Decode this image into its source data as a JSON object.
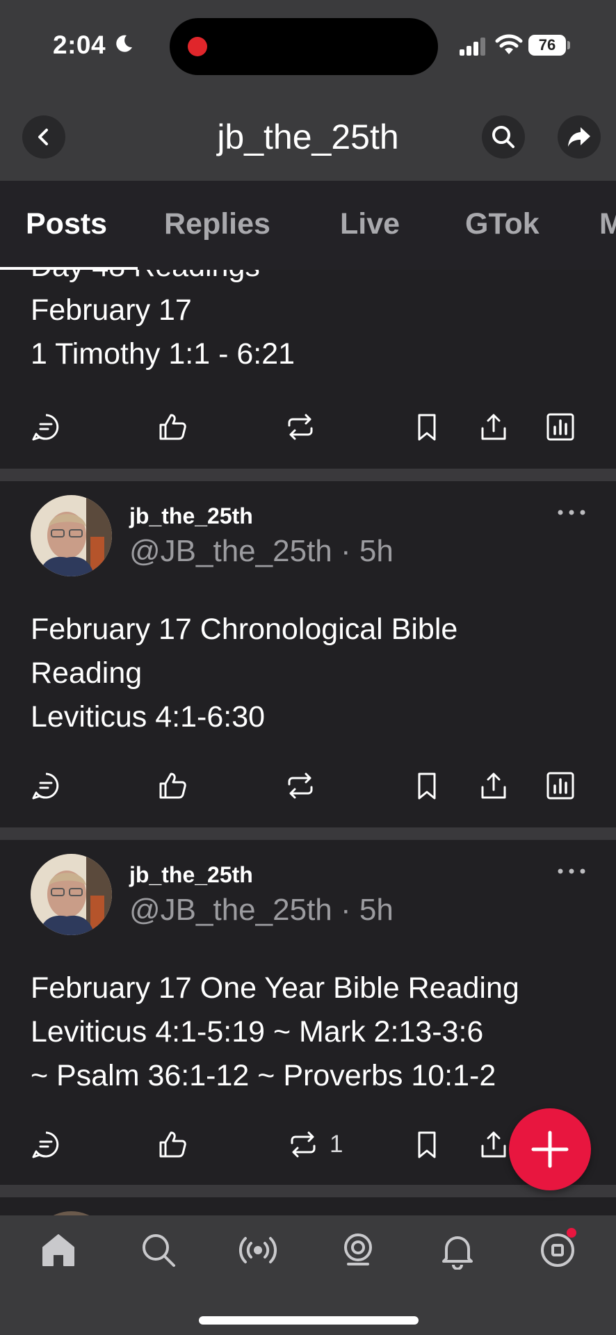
{
  "status_bar": {
    "time": "2:04",
    "battery": "76"
  },
  "header": {
    "title": "jb_the_25th"
  },
  "tabs": [
    {
      "label": "Posts",
      "active": true
    },
    {
      "label": "Replies"
    },
    {
      "label": "Live"
    },
    {
      "label": "GTok"
    },
    {
      "label": "M"
    }
  ],
  "posts": [
    {
      "lines": [
        "Day 48 Readings",
        "February 17",
        "1 Timothy 1:1 - 6:21"
      ]
    },
    {
      "username": "jb_the_25th",
      "handle_time": "@JB_the_25th · 5h",
      "lines": [
        "February 17 Chronological Bible",
        "Reading",
        "Leviticus 4:1-6:30"
      ]
    },
    {
      "username": "jb_the_25th",
      "handle_time": "@JB_the_25th · 5h",
      "lines": [
        "February 17 One Year Bible Reading",
        "Leviticus 4:1-5:19 ~ Mark 2:13-3:6",
        "~ Psalm 36:1-12 ~ Proverbs 10:1-2"
      ],
      "repost_count": "1"
    }
  ],
  "icons": {
    "reply": "reply-icon",
    "like": "like-icon",
    "repost": "repost-icon",
    "bookmark": "bookmark-icon",
    "share": "share-icon",
    "stats": "stats-icon"
  },
  "colors": {
    "accent": "#e8163f",
    "background": "#212023",
    "bar": "#3b3b3d"
  }
}
